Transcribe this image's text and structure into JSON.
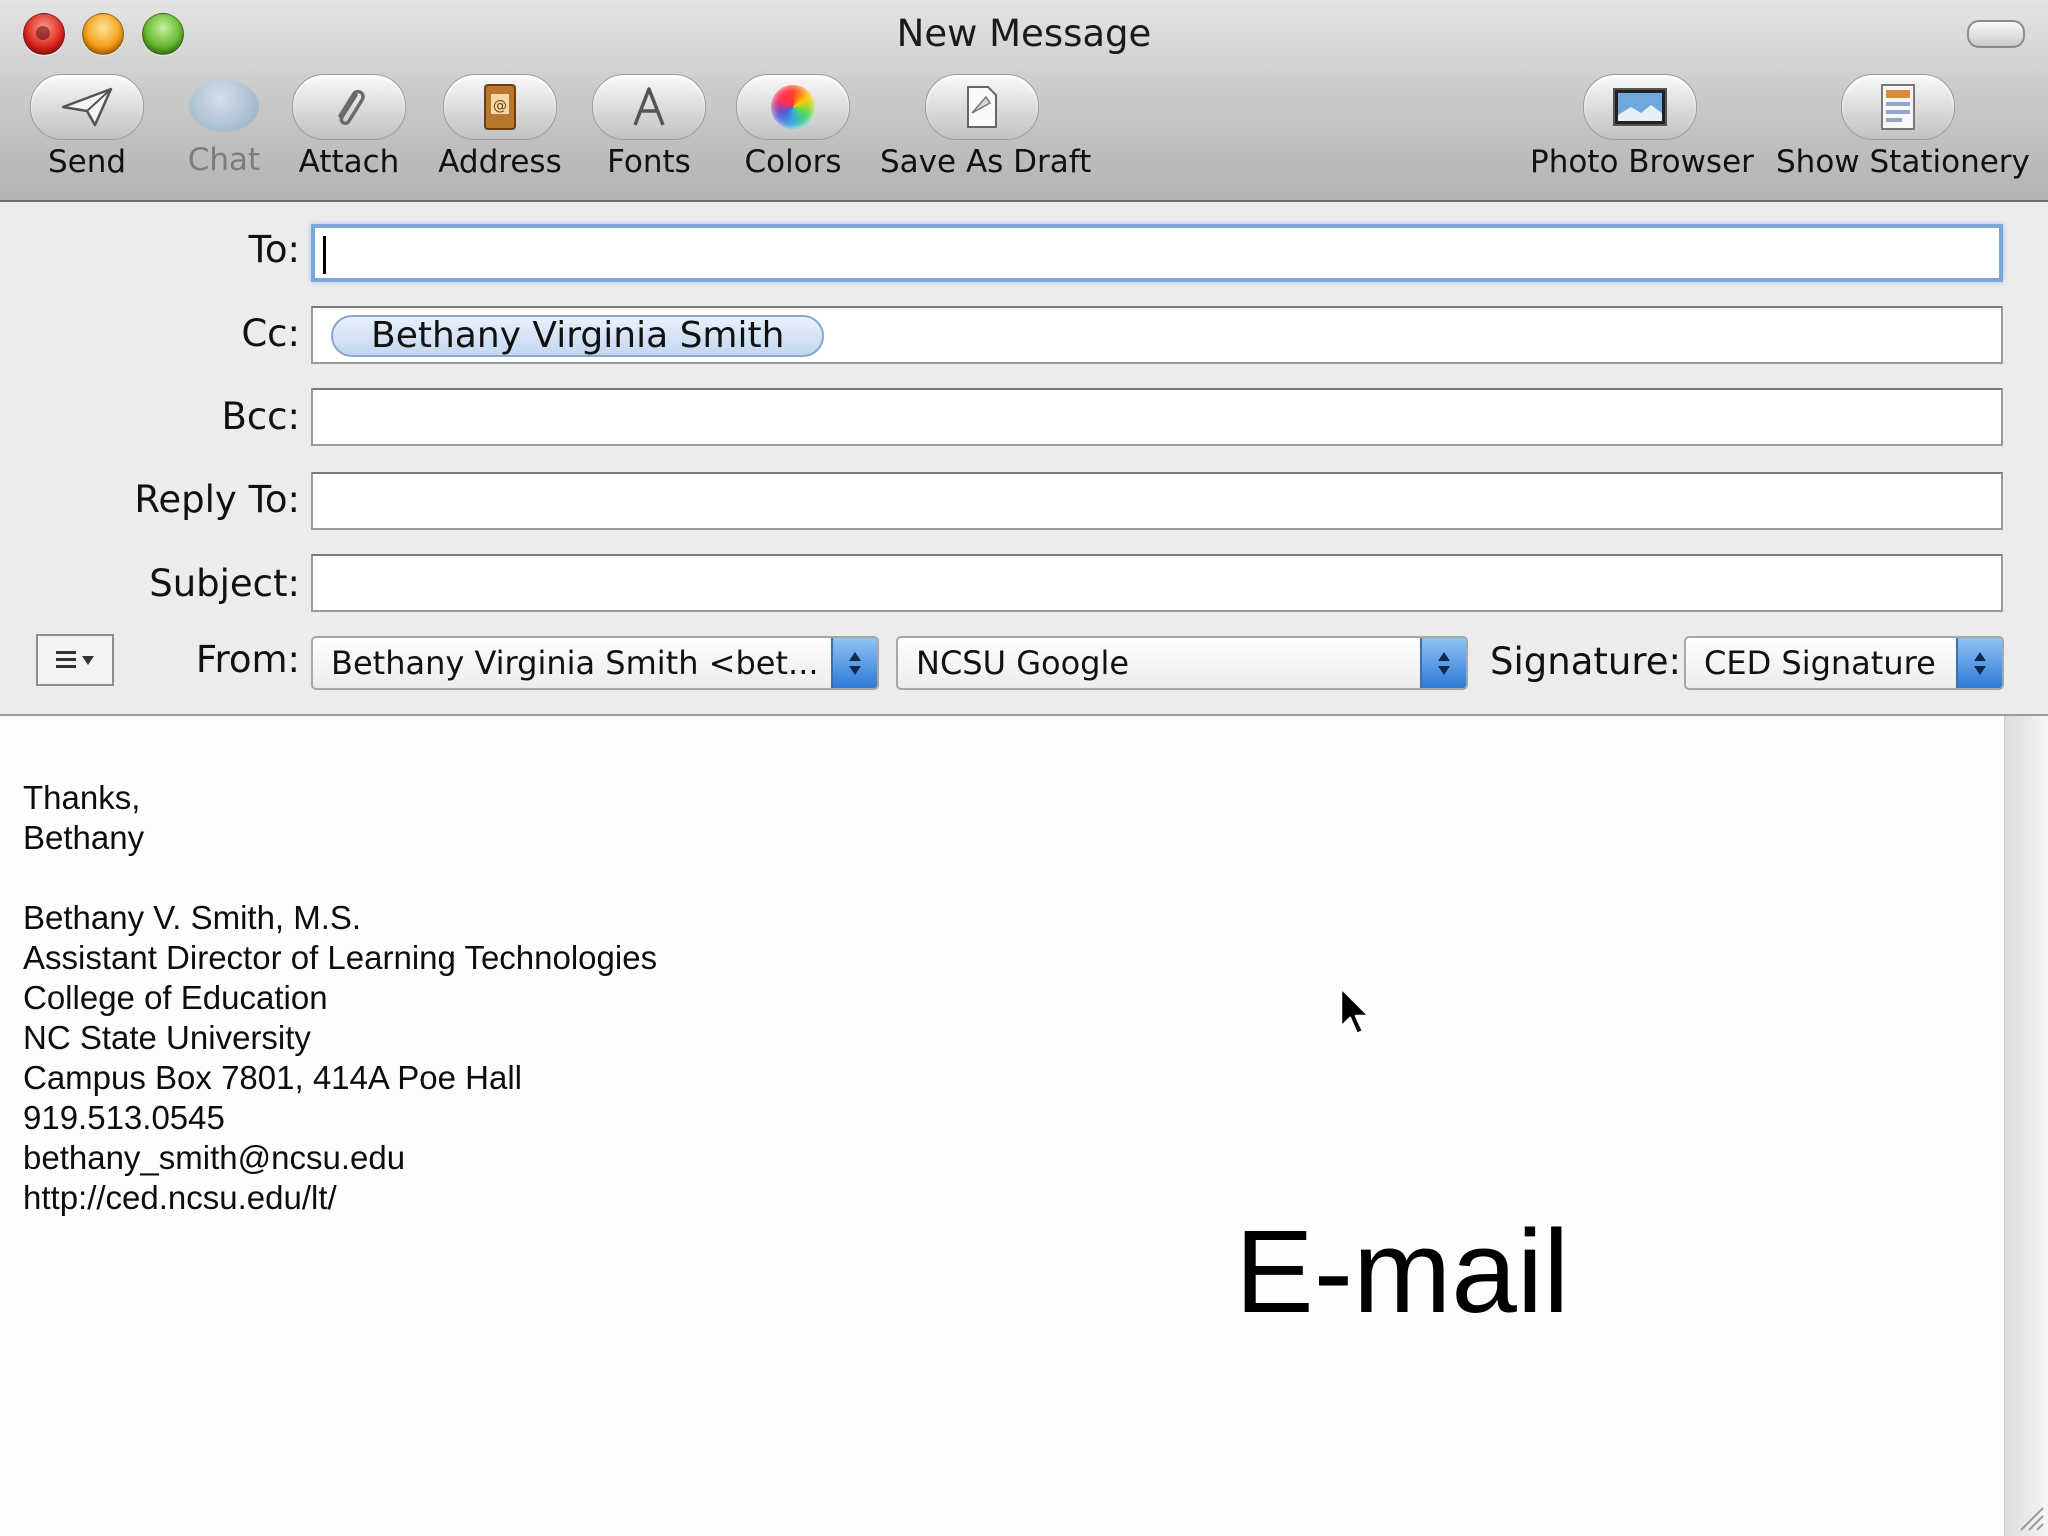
{
  "window": {
    "title": "New Message"
  },
  "toolbar": {
    "items": [
      {
        "id": "send",
        "label": "Send",
        "icon": "paper-plane-icon",
        "enabled": true
      },
      {
        "id": "chat",
        "label": "Chat",
        "icon": "chat-bubble-icon",
        "enabled": false
      },
      {
        "id": "attach",
        "label": "Attach",
        "icon": "paperclip-icon",
        "enabled": true
      },
      {
        "id": "address",
        "label": "Address",
        "icon": "address-book-icon",
        "enabled": true
      },
      {
        "id": "fonts",
        "label": "Fonts",
        "icon": "font-a-icon",
        "enabled": true
      },
      {
        "id": "colors",
        "label": "Colors",
        "icon": "color-wheel-icon",
        "enabled": true
      },
      {
        "id": "save_draft",
        "label": "Save As Draft",
        "icon": "draft-page-icon",
        "enabled": true
      },
      {
        "id": "photo_browser",
        "label": "Photo Browser",
        "icon": "photo-icon",
        "enabled": true
      },
      {
        "id": "show_stationery",
        "label": "Show Stationery",
        "icon": "stationery-icon",
        "enabled": true
      }
    ]
  },
  "header": {
    "to": {
      "label": "To:",
      "value": ""
    },
    "cc": {
      "label": "Cc:",
      "tokens": [
        "Bethany Virginia Smith"
      ]
    },
    "bcc": {
      "label": "Bcc:",
      "value": ""
    },
    "reply_to": {
      "label": "Reply To:",
      "value": ""
    },
    "subject": {
      "label": "Subject:",
      "value": ""
    },
    "from": {
      "label": "From:",
      "value": "Bethany Virginia Smith <bet...",
      "account": "NCSU Google"
    },
    "signature": {
      "label": "Signature:",
      "value": "CED Signature"
    }
  },
  "body": {
    "lines": [
      "Thanks,",
      "Bethany",
      "",
      "Bethany V. Smith, M.S.",
      "Assistant Director of Learning Technologies",
      "College of Education",
      "NC State University",
      "Campus Box 7801, 414A Poe Hall",
      "919.513.0545",
      "bethany_smith@ncsu.edu",
      "http://ced.ncsu.edu/lt/"
    ]
  },
  "caption": "E-mail",
  "colors": {
    "focus_ring": "#7aa7d9",
    "stepper": "#2d7ad6",
    "token_border": "#8aa7cf"
  }
}
